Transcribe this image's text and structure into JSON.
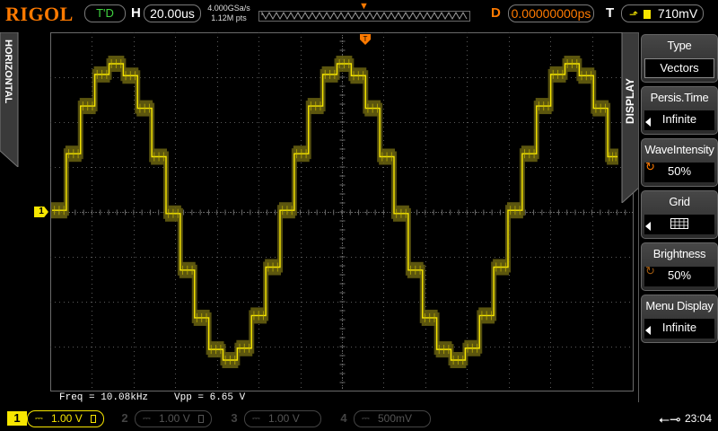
{
  "brand": "RIGOL",
  "trigger_status": "T'D",
  "horizontal": {
    "letter": "H",
    "timebase": "20.00us"
  },
  "acquisition": {
    "sample_rate": "4.000GSa/s",
    "memory_depth": "1.12M pts"
  },
  "delay": {
    "letter": "D",
    "value": "0.00000000ps"
  },
  "trigger": {
    "letter": "T",
    "level": "710mV",
    "edge_icon": "rising-edge-icon"
  },
  "left_tab": "HORIZONTAL",
  "right_tab": "DISPLAY",
  "channel_marker": "1",
  "menu": {
    "type": {
      "title": "Type",
      "value": "Vectors"
    },
    "persis": {
      "title": "Persis.Time",
      "value": "Infinite"
    },
    "intensity": {
      "title": "WaveIntensity",
      "value": "50%"
    },
    "grid": {
      "title": "Grid",
      "value_icon": "grid-icon"
    },
    "brightness": {
      "title": "Brightness",
      "value": "50%"
    },
    "menu_display": {
      "title": "Menu Display",
      "value": "Infinite"
    }
  },
  "measurements": {
    "freq": "Freq = 10.08kHz",
    "vpp": "Vpp = 6.65 V"
  },
  "channels": [
    {
      "num": "1",
      "scale": "1.00 V",
      "active": true,
      "color": "#f7e600"
    },
    {
      "num": "2",
      "scale": "1.00 V",
      "active": false,
      "color": "#00c8ff"
    },
    {
      "num": "3",
      "scale": "1.00 V",
      "active": false,
      "color": "#ff33cc"
    },
    {
      "num": "4",
      "scale": "500mV",
      "active": false,
      "color": "#2080ff"
    }
  ],
  "clock": "23:04",
  "colors": {
    "accent": "#ff7a00",
    "ch1": "#f7e600",
    "trig_status": "#3fd23f",
    "grid": "#5a5a5a"
  },
  "waveform": {
    "signal": "stepped sine",
    "cycles_visible": 2.6
  }
}
